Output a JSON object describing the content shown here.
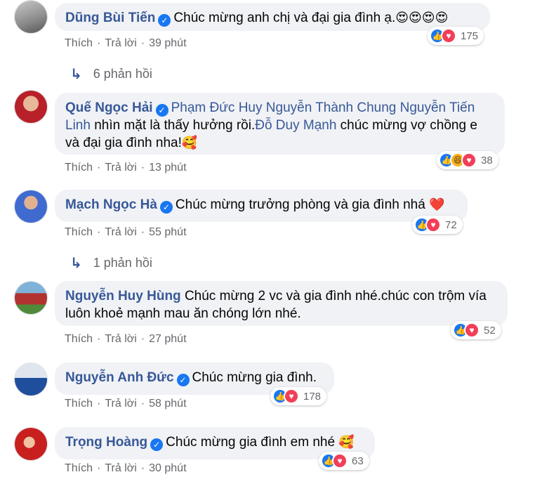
{
  "colors": {
    "name": "#385898",
    "bubble": "#f0f2f5",
    "meta": "#65676b",
    "like": "#1877f2",
    "love": "#f33e58",
    "haha": "#f7b125"
  },
  "labels": {
    "like": "Thích",
    "reply": "Trả lời",
    "sep": "·"
  },
  "comments": [
    {
      "author": "Dũng Bùi Tiến",
      "verified": true,
      "text": "Chúc mừng anh chị và đại gia đình ạ.",
      "emoji": "😍😍😍😍",
      "time": "39 phút",
      "reaction_icons": [
        "like-icon",
        "love-icon"
      ],
      "reaction_count": "175",
      "replies": "6 phản hồi"
    },
    {
      "author": "Quế Ngọc Hải",
      "verified": true,
      "mention_1": "Phạm Đức Huy Nguyễn Thành Chung Nguyễn Tiến Linh",
      "text_1": " nhìn mặt là thấy hưởng rồi.",
      "mention_2": "Đỗ Duy Mạnh",
      "text_2": " chúc mừng vợ chồng e và đại gia đình nha!",
      "emoji": "🥰",
      "time": "13 phút",
      "reaction_icons": [
        "like-icon",
        "haha-icon",
        "love-icon"
      ],
      "reaction_count": "38"
    },
    {
      "author": "Mạch Ngọc Hà",
      "verified": true,
      "text": "Chúc mừng trưởng phòng và gia đình nhá",
      "emoji": "❤️",
      "time": "55 phút",
      "reaction_icons": [
        "like-icon",
        "love-icon"
      ],
      "reaction_count": "72",
      "replies": "1 phản hồi"
    },
    {
      "author": "Nguyễn Huy Hùng",
      "verified": false,
      "text": "Chúc mừng 2 vc và gia đình nhé.chúc con trộm vía luôn khoẻ mạnh mau ăn chóng lớn nhé.",
      "time": "27 phút",
      "reaction_icons": [
        "like-icon",
        "love-icon"
      ],
      "reaction_count": "52"
    },
    {
      "author": "Nguyễn Anh Đức",
      "verified": true,
      "text": "Chúc mừng gia đình.",
      "time": "58 phút",
      "reaction_icons": [
        "like-icon",
        "love-icon"
      ],
      "reaction_count": "178"
    },
    {
      "author": "Trọng Hoàng",
      "verified": true,
      "text": "Chúc mừng gia đình em nhé",
      "emoji": "🥰",
      "time": "30 phút",
      "reaction_icons": [
        "like-icon",
        "love-icon"
      ],
      "reaction_count": "63"
    }
  ]
}
